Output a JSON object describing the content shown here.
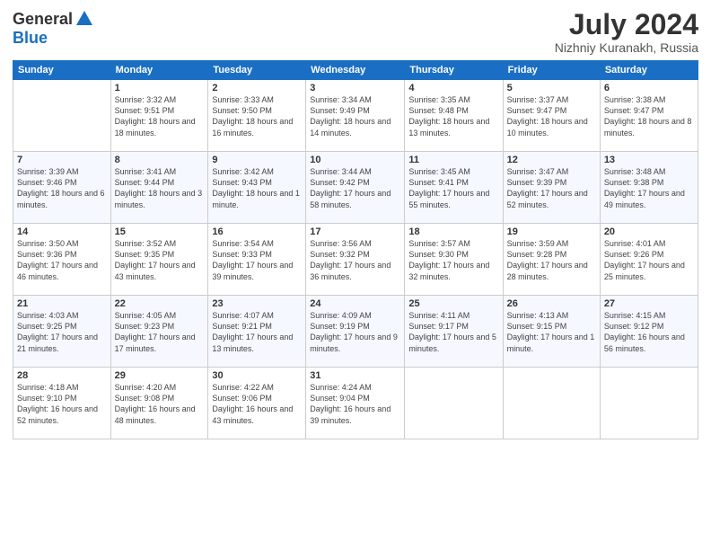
{
  "header": {
    "logo_general": "General",
    "logo_blue": "Blue",
    "month": "July 2024",
    "location": "Nizhniy Kuranakh, Russia"
  },
  "weekdays": [
    "Sunday",
    "Monday",
    "Tuesday",
    "Wednesday",
    "Thursday",
    "Friday",
    "Saturday"
  ],
  "weeks": [
    [
      {
        "day": "",
        "sunrise": "",
        "sunset": "",
        "daylight": ""
      },
      {
        "day": "1",
        "sunrise": "Sunrise: 3:32 AM",
        "sunset": "Sunset: 9:51 PM",
        "daylight": "Daylight: 18 hours and 18 minutes."
      },
      {
        "day": "2",
        "sunrise": "Sunrise: 3:33 AM",
        "sunset": "Sunset: 9:50 PM",
        "daylight": "Daylight: 18 hours and 16 minutes."
      },
      {
        "day": "3",
        "sunrise": "Sunrise: 3:34 AM",
        "sunset": "Sunset: 9:49 PM",
        "daylight": "Daylight: 18 hours and 14 minutes."
      },
      {
        "day": "4",
        "sunrise": "Sunrise: 3:35 AM",
        "sunset": "Sunset: 9:48 PM",
        "daylight": "Daylight: 18 hours and 13 minutes."
      },
      {
        "day": "5",
        "sunrise": "Sunrise: 3:37 AM",
        "sunset": "Sunset: 9:47 PM",
        "daylight": "Daylight: 18 hours and 10 minutes."
      },
      {
        "day": "6",
        "sunrise": "Sunrise: 3:38 AM",
        "sunset": "Sunset: 9:47 PM",
        "daylight": "Daylight: 18 hours and 8 minutes."
      }
    ],
    [
      {
        "day": "7",
        "sunrise": "Sunrise: 3:39 AM",
        "sunset": "Sunset: 9:46 PM",
        "daylight": "Daylight: 18 hours and 6 minutes."
      },
      {
        "day": "8",
        "sunrise": "Sunrise: 3:41 AM",
        "sunset": "Sunset: 9:44 PM",
        "daylight": "Daylight: 18 hours and 3 minutes."
      },
      {
        "day": "9",
        "sunrise": "Sunrise: 3:42 AM",
        "sunset": "Sunset: 9:43 PM",
        "daylight": "Daylight: 18 hours and 1 minute."
      },
      {
        "day": "10",
        "sunrise": "Sunrise: 3:44 AM",
        "sunset": "Sunset: 9:42 PM",
        "daylight": "Daylight: 17 hours and 58 minutes."
      },
      {
        "day": "11",
        "sunrise": "Sunrise: 3:45 AM",
        "sunset": "Sunset: 9:41 PM",
        "daylight": "Daylight: 17 hours and 55 minutes."
      },
      {
        "day": "12",
        "sunrise": "Sunrise: 3:47 AM",
        "sunset": "Sunset: 9:39 PM",
        "daylight": "Daylight: 17 hours and 52 minutes."
      },
      {
        "day": "13",
        "sunrise": "Sunrise: 3:48 AM",
        "sunset": "Sunset: 9:38 PM",
        "daylight": "Daylight: 17 hours and 49 minutes."
      }
    ],
    [
      {
        "day": "14",
        "sunrise": "Sunrise: 3:50 AM",
        "sunset": "Sunset: 9:36 PM",
        "daylight": "Daylight: 17 hours and 46 minutes."
      },
      {
        "day": "15",
        "sunrise": "Sunrise: 3:52 AM",
        "sunset": "Sunset: 9:35 PM",
        "daylight": "Daylight: 17 hours and 43 minutes."
      },
      {
        "day": "16",
        "sunrise": "Sunrise: 3:54 AM",
        "sunset": "Sunset: 9:33 PM",
        "daylight": "Daylight: 17 hours and 39 minutes."
      },
      {
        "day": "17",
        "sunrise": "Sunrise: 3:56 AM",
        "sunset": "Sunset: 9:32 PM",
        "daylight": "Daylight: 17 hours and 36 minutes."
      },
      {
        "day": "18",
        "sunrise": "Sunrise: 3:57 AM",
        "sunset": "Sunset: 9:30 PM",
        "daylight": "Daylight: 17 hours and 32 minutes."
      },
      {
        "day": "19",
        "sunrise": "Sunrise: 3:59 AM",
        "sunset": "Sunset: 9:28 PM",
        "daylight": "Daylight: 17 hours and 28 minutes."
      },
      {
        "day": "20",
        "sunrise": "Sunrise: 4:01 AM",
        "sunset": "Sunset: 9:26 PM",
        "daylight": "Daylight: 17 hours and 25 minutes."
      }
    ],
    [
      {
        "day": "21",
        "sunrise": "Sunrise: 4:03 AM",
        "sunset": "Sunset: 9:25 PM",
        "daylight": "Daylight: 17 hours and 21 minutes."
      },
      {
        "day": "22",
        "sunrise": "Sunrise: 4:05 AM",
        "sunset": "Sunset: 9:23 PM",
        "daylight": "Daylight: 17 hours and 17 minutes."
      },
      {
        "day": "23",
        "sunrise": "Sunrise: 4:07 AM",
        "sunset": "Sunset: 9:21 PM",
        "daylight": "Daylight: 17 hours and 13 minutes."
      },
      {
        "day": "24",
        "sunrise": "Sunrise: 4:09 AM",
        "sunset": "Sunset: 9:19 PM",
        "daylight": "Daylight: 17 hours and 9 minutes."
      },
      {
        "day": "25",
        "sunrise": "Sunrise: 4:11 AM",
        "sunset": "Sunset: 9:17 PM",
        "daylight": "Daylight: 17 hours and 5 minutes."
      },
      {
        "day": "26",
        "sunrise": "Sunrise: 4:13 AM",
        "sunset": "Sunset: 9:15 PM",
        "daylight": "Daylight: 17 hours and 1 minute."
      },
      {
        "day": "27",
        "sunrise": "Sunrise: 4:15 AM",
        "sunset": "Sunset: 9:12 PM",
        "daylight": "Daylight: 16 hours and 56 minutes."
      }
    ],
    [
      {
        "day": "28",
        "sunrise": "Sunrise: 4:18 AM",
        "sunset": "Sunset: 9:10 PM",
        "daylight": "Daylight: 16 hours and 52 minutes."
      },
      {
        "day": "29",
        "sunrise": "Sunrise: 4:20 AM",
        "sunset": "Sunset: 9:08 PM",
        "daylight": "Daylight: 16 hours and 48 minutes."
      },
      {
        "day": "30",
        "sunrise": "Sunrise: 4:22 AM",
        "sunset": "Sunset: 9:06 PM",
        "daylight": "Daylight: 16 hours and 43 minutes."
      },
      {
        "day": "31",
        "sunrise": "Sunrise: 4:24 AM",
        "sunset": "Sunset: 9:04 PM",
        "daylight": "Daylight: 16 hours and 39 minutes."
      },
      {
        "day": "",
        "sunrise": "",
        "sunset": "",
        "daylight": ""
      },
      {
        "day": "",
        "sunrise": "",
        "sunset": "",
        "daylight": ""
      },
      {
        "day": "",
        "sunrise": "",
        "sunset": "",
        "daylight": ""
      }
    ]
  ]
}
